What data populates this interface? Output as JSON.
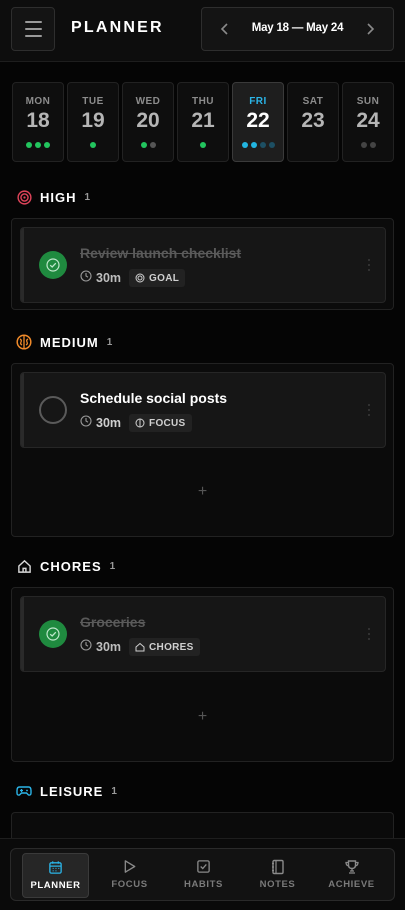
{
  "header": {
    "title": "PLANNER",
    "week_range": "May 18 — May 24",
    "prev_icon": "chevron-left-icon",
    "next_icon": "chevron-right-icon",
    "menu_icon": "hamburger-menu-icon"
  },
  "days": [
    {
      "dow": "MON",
      "num": "18",
      "dots": [
        "#22c55e",
        "#22c55e",
        "#22c55e"
      ],
      "active": false
    },
    {
      "dow": "TUE",
      "num": "19",
      "dots": [
        "#22c55e"
      ],
      "active": false
    },
    {
      "dow": "WED",
      "num": "20",
      "dots": [
        "#22c55e",
        "#555555"
      ],
      "active": false
    },
    {
      "dow": "THU",
      "num": "21",
      "dots": [
        "#22c55e"
      ],
      "active": false
    },
    {
      "dow": "FRI",
      "num": "22",
      "dots": [
        "#22b5e0",
        "#22b5e0",
        "#1d4f63",
        "#1d4f63"
      ],
      "active": true
    },
    {
      "dow": "SAT",
      "num": "23",
      "dots": [],
      "active": false
    },
    {
      "dow": "SUN",
      "num": "24",
      "dots": [
        "#444444",
        "#444444"
      ],
      "active": false
    }
  ],
  "sections": {
    "high": {
      "title": "HIGH",
      "count": "1",
      "icon": "target-icon",
      "color": "#e0445a",
      "task": {
        "title": "Review launch checklist",
        "duration": "30m",
        "tag": "GOAL",
        "tag_icon": "target-icon",
        "completed": true
      }
    },
    "medium": {
      "title": "MEDIUM",
      "count": "1",
      "icon": "brain-icon",
      "color": "#f08a2a",
      "task": {
        "title": "Schedule social posts",
        "duration": "30m",
        "tag": "FOCUS",
        "tag_icon": "brain-icon",
        "completed": false
      },
      "add_label": "+"
    },
    "chores": {
      "title": "CHORES",
      "count": "1",
      "icon": "home-icon",
      "color": "#d8d8d8",
      "task": {
        "title": "Groceries",
        "duration": "30m",
        "tag": "CHORES",
        "tag_icon": "home-icon",
        "completed": true
      },
      "add_label": "+"
    },
    "leisure": {
      "title": "LEISURE",
      "count": "1",
      "icon": "gamepad-icon",
      "color": "#2bb5e8"
    }
  },
  "bottom_nav": [
    {
      "label": "PLANNER",
      "icon": "calendar-icon",
      "active": true
    },
    {
      "label": "FOCUS",
      "icon": "play-icon",
      "active": false
    },
    {
      "label": "HABITS",
      "icon": "checkbox-icon",
      "active": false
    },
    {
      "label": "NOTES",
      "icon": "notebook-icon",
      "active": false
    },
    {
      "label": "ACHIEVE",
      "icon": "trophy-icon",
      "active": false
    }
  ],
  "colors": {
    "accent": "#2bb5e8",
    "done": "#1f8a3f",
    "background": "#050505"
  }
}
